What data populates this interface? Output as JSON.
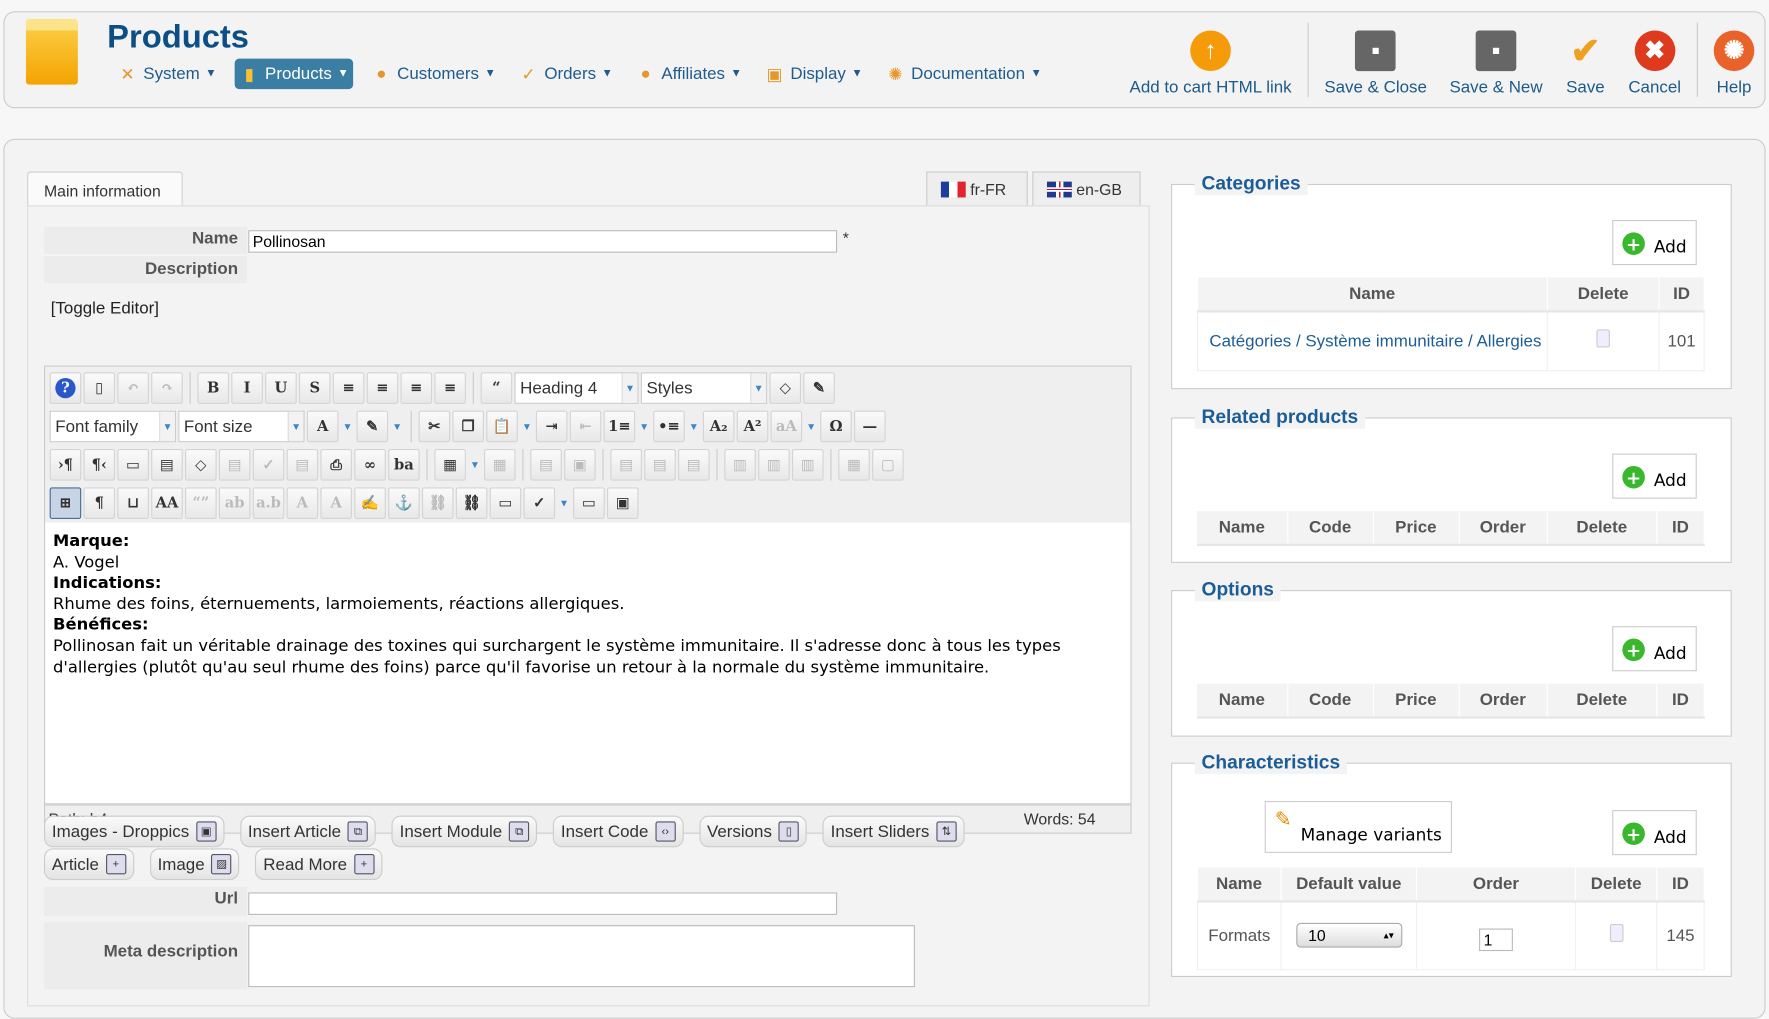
{
  "header": {
    "title": "Products",
    "menu": [
      {
        "label": "System",
        "icon": "wrench-icon",
        "glyph": "✕"
      },
      {
        "label": "Products",
        "icon": "box-icon",
        "glyph": "▮",
        "active": true
      },
      {
        "label": "Customers",
        "icon": "user-icon",
        "glyph": "●"
      },
      {
        "label": "Orders",
        "icon": "orders-icon",
        "glyph": "✓"
      },
      {
        "label": "Affiliates",
        "icon": "affiliates-icon",
        "glyph": "●"
      },
      {
        "label": "Display",
        "icon": "display-icon",
        "glyph": "▣"
      },
      {
        "label": "Documentation",
        "icon": "lifebuoy-icon",
        "glyph": "✺"
      }
    ],
    "actions": [
      {
        "label": "Add to cart HTML link",
        "icon": "upload-arrow-icon",
        "glyph": "↑",
        "color": "#f59b0a"
      },
      {
        "sep": true
      },
      {
        "label": "Save & Close",
        "icon": "floppy-icon",
        "glyph": "▪",
        "color": "#666"
      },
      {
        "label": "Save & New",
        "icon": "floppy-plus-icon",
        "glyph": "▪",
        "color": "#666"
      },
      {
        "label": "Save",
        "icon": "checkmark-icon",
        "glyph": "✔",
        "color": "#f0a020"
      },
      {
        "label": "Cancel",
        "icon": "cancel-icon",
        "glyph": "✖",
        "color": "#dd3a1e"
      },
      {
        "sep": true
      },
      {
        "label": "Help",
        "icon": "help-lifebuoy-icon",
        "glyph": "✺",
        "color": "#e8622a"
      }
    ]
  },
  "tabs": {
    "main": "Main information",
    "langs": [
      {
        "label": "fr-FR",
        "colors": [
          "#1d3e9b",
          "#fff",
          "#e0232c"
        ]
      },
      {
        "label": "en-GB",
        "colors": [
          "#1f3a8a",
          "#c8102e",
          "#1f3a8a"
        ]
      }
    ]
  },
  "form": {
    "name_label": "Name",
    "name_value": "Pollinosan",
    "required": "*",
    "description_label": "Description",
    "toggle_editor": "[Toggle Editor]",
    "url_label": "Url",
    "url_value": "",
    "meta_label": "Meta description",
    "meta_value": ""
  },
  "editor": {
    "toolbar": [
      [
        {
          "n": "help-icon",
          "g": "?"
        },
        {
          "n": "new-document-icon",
          "g": "▯"
        },
        {
          "n": "undo-icon",
          "g": "↶",
          "d": 1
        },
        {
          "n": "redo-icon",
          "g": "↷",
          "d": 1
        },
        {
          "s": 1
        },
        {
          "n": "bold-icon",
          "g": "B"
        },
        {
          "n": "italic-icon",
          "g": "I"
        },
        {
          "n": "underline-icon",
          "g": "U"
        },
        {
          "n": "strikethrough-icon",
          "g": "S"
        },
        {
          "n": "justify-full-icon",
          "g": "≡"
        },
        {
          "n": "align-center-icon",
          "g": "≡"
        },
        {
          "n": "align-left-icon",
          "g": "≡"
        },
        {
          "n": "align-right-icon",
          "g": "≡"
        },
        {
          "s": 1
        },
        {
          "n": "blockquote-icon",
          "g": "“"
        },
        {
          "sel": "Heading 4",
          "n": "format-select",
          "w": 110
        },
        {
          "sel": "Styles",
          "n": "styles-select",
          "w": 112
        },
        {
          "n": "eraser-icon",
          "g": "◇"
        },
        {
          "n": "cleanup-brush-icon",
          "g": "✎"
        }
      ],
      [
        {
          "sel": "Font family",
          "n": "font-family-select",
          "w": 112
        },
        {
          "sel": "Font size",
          "n": "font-size-select",
          "w": 112
        },
        {
          "n": "text-color-icon",
          "g": "A"
        },
        {
          "dd": 1
        },
        {
          "n": "highlight-color-icon",
          "g": "✎"
        },
        {
          "dd": 1
        },
        {
          "s": 1
        },
        {
          "n": "cut-icon",
          "g": "✂"
        },
        {
          "n": "copy-icon",
          "g": "❐"
        },
        {
          "n": "paste-icon",
          "g": "📋"
        },
        {
          "dd": 1
        },
        {
          "n": "indent-icon",
          "g": "⇥"
        },
        {
          "n": "outdent-icon",
          "g": "⇤",
          "d": 1
        },
        {
          "n": "ordered-list-icon",
          "g": "1≡"
        },
        {
          "dd": 1
        },
        {
          "n": "bullet-list-icon",
          "g": "•≡"
        },
        {
          "dd": 1
        },
        {
          "n": "subscript-icon",
          "g": "A₂"
        },
        {
          "n": "superscript-icon",
          "g": "A²"
        },
        {
          "n": "style-icon",
          "g": "aA",
          "d": 1
        },
        {
          "dd": 1
        },
        {
          "n": "special-char-icon",
          "g": "Ω"
        },
        {
          "n": "horizontal-rule-icon",
          "g": "—"
        }
      ],
      [
        {
          "n": "ltr-icon",
          "g": "›¶"
        },
        {
          "n": "rtl-icon",
          "g": "¶‹"
        },
        {
          "n": "preview-icon",
          "g": "▭"
        },
        {
          "n": "template-icon",
          "g": "▤"
        },
        {
          "n": "code-icon",
          "g": "◇"
        },
        {
          "n": "doc-icon",
          "g": "▤",
          "d": 1
        },
        {
          "n": "doc-check-icon",
          "g": "✓",
          "d": 1
        },
        {
          "n": "doc-list-icon",
          "g": "▤",
          "d": 1
        },
        {
          "n": "print-icon",
          "g": "⎙"
        },
        {
          "n": "search-binoculars-icon",
          "g": "∞"
        },
        {
          "n": "replace-icon",
          "g": "ba"
        },
        {
          "s": 1
        },
        {
          "n": "table-icon",
          "g": "▦"
        },
        {
          "dd": 1
        },
        {
          "n": "table-delete-icon",
          "g": "▦",
          "d": 1
        },
        {
          "s": 1
        },
        {
          "n": "row-props-icon",
          "g": "▤",
          "d": 1
        },
        {
          "n": "cell-props-icon",
          "g": "▣",
          "d": 1
        },
        {
          "s": 1
        },
        {
          "n": "row-before-icon",
          "g": "▤",
          "d": 1
        },
        {
          "n": "row-after-icon",
          "g": "▤",
          "d": 1
        },
        {
          "n": "row-delete-icon",
          "g": "▤",
          "d": 1
        },
        {
          "s": 1
        },
        {
          "n": "col-before-icon",
          "g": "▥",
          "d": 1
        },
        {
          "n": "col-after-icon",
          "g": "▥",
          "d": 1
        },
        {
          "n": "col-delete-icon",
          "g": "▥",
          "d": 1
        },
        {
          "s": 1
        },
        {
          "n": "split-cells-icon",
          "g": "▦",
          "d": 1
        },
        {
          "n": "merge-cells-icon",
          "g": "▢",
          "d": 1
        }
      ],
      [
        {
          "n": "visual-aid-icon",
          "g": "⊞",
          "on": 1
        },
        {
          "n": "paragraph-icon",
          "g": "¶"
        },
        {
          "n": "nonbreaking-icon",
          "g": "⊔"
        },
        {
          "n": "font-style-icon",
          "g": "AA"
        },
        {
          "n": "cite-icon",
          "g": "“”",
          "d": 1
        },
        {
          "n": "abbr-icon",
          "g": "ab",
          "d": 1
        },
        {
          "n": "acronym-icon",
          "g": "a.b",
          "d": 1
        },
        {
          "n": "del-icon",
          "g": "A",
          "d": 1
        },
        {
          "n": "ins-icon",
          "g": "A",
          "d": 1
        },
        {
          "n": "attributes-icon",
          "g": "✍"
        },
        {
          "n": "anchor-icon",
          "g": "⚓"
        },
        {
          "n": "unlink-icon",
          "g": "⛓",
          "d": 1
        },
        {
          "n": "link-icon",
          "g": "⛓"
        },
        {
          "n": "image-icon",
          "g": "▭"
        },
        {
          "n": "spellcheck-icon",
          "g": "✓"
        },
        {
          "dd": 1
        },
        {
          "n": "pagebreak-icon",
          "g": "▭"
        },
        {
          "n": "layer-icon",
          "g": "▣"
        }
      ]
    ],
    "content": [
      {
        "b": "Marque:"
      },
      {
        "t": "A. Vogel"
      },
      {
        "b": "Indications:"
      },
      {
        "t": "Rhume des foins, éternuements, larmoiements, réactions allergiques."
      },
      {
        "b": "Bénéfices:"
      },
      {
        "t": "Pollinosan fait un véritable drainage des toxines qui surchargent le système immunitaire. Il s'adresse donc à tous les types d'allergies (plutôt qu'au seul rhume des foins) parce qu'il favorise un retour à la normale du système immunitaire."
      }
    ],
    "path": "Path:  h4",
    "words": "Words: 54"
  },
  "editor_buttons": [
    [
      {
        "label": "Images - Droppics",
        "icon": "droppics-icon",
        "g": "▣"
      },
      {
        "label": "Insert Article",
        "icon": "insert-article-icon",
        "g": "⧉"
      },
      {
        "label": "Insert Module",
        "icon": "insert-module-icon",
        "g": "⧉"
      },
      {
        "label": "Insert Code",
        "icon": "code-brackets-icon",
        "g": "‹›"
      },
      {
        "label": "Versions",
        "icon": "versions-icon",
        "g": "▯"
      },
      {
        "label": "Insert Sliders",
        "icon": "sliders-icon",
        "g": "⇅"
      }
    ],
    [
      {
        "label": "Article",
        "icon": "article-add-icon",
        "g": "+"
      },
      {
        "label": "Image",
        "icon": "image-icon",
        "g": "▨"
      },
      {
        "label": "Read More",
        "icon": "readmore-icon",
        "g": "+"
      }
    ]
  ],
  "categories": {
    "title": "Categories",
    "add": "Add",
    "headers": [
      "Name",
      "Delete",
      "ID"
    ],
    "rows": [
      {
        "name": "Catégories / Système immunitaire / Allergies",
        "id": "101"
      }
    ]
  },
  "related": {
    "title": "Related products",
    "add": "Add",
    "headers": [
      "Name",
      "Code",
      "Price",
      "Order",
      "Delete",
      "ID"
    ]
  },
  "options": {
    "title": "Options",
    "add": "Add",
    "headers": [
      "Name",
      "Code",
      "Price",
      "Order",
      "Delete",
      "ID"
    ]
  },
  "characteristics": {
    "title": "Characteristics",
    "manage": "Manage variants",
    "add": "Add",
    "headers": [
      "Name",
      "Default value",
      "Order",
      "Delete",
      "ID"
    ],
    "rows": [
      {
        "name": "Formats",
        "default": "10",
        "order": "1",
        "id": "145"
      }
    ]
  }
}
